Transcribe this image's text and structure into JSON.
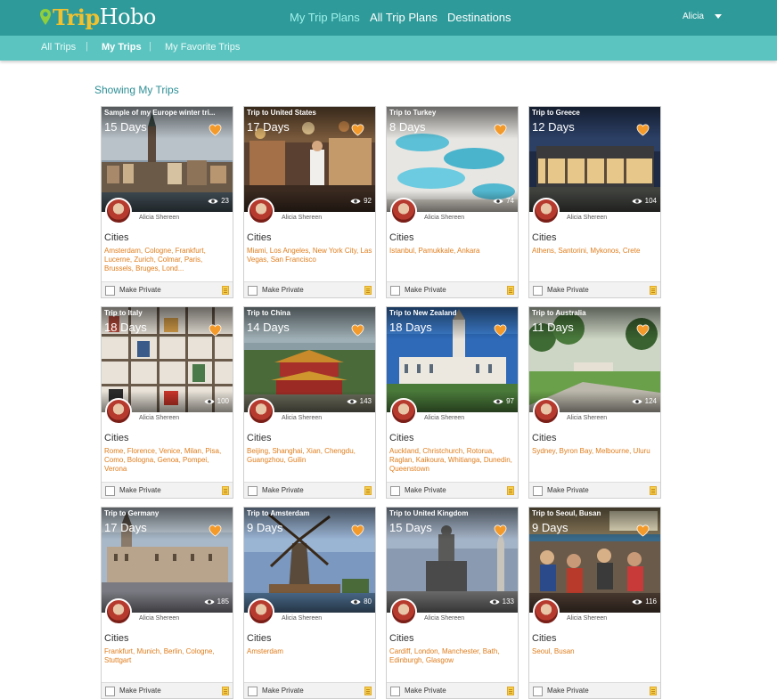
{
  "brand": {
    "trip": "Trip",
    "hobo": "Hobo"
  },
  "nav": {
    "my_trip_plans": "My Trip Plans",
    "all_trip_plans": "All Trip Plans",
    "destinations": "Destinations",
    "user": "Alicia"
  },
  "subnav": {
    "all_trips": "All Trips",
    "my_trips": "My Trips",
    "my_favorite_trips": "My Favorite Trips",
    "separator": "|"
  },
  "showing": "Showing My Trips",
  "colors": {
    "primary": "#2e9a9a",
    "secondary": "#5cc4c0",
    "accent": "#e07d1c",
    "heart": "#f39a2b"
  },
  "card_common": {
    "author": "Alicia Shereen",
    "category": "Cities",
    "make_private": "Make Private"
  },
  "cards": [
    {
      "title": "Sample of my Europe winter tri...",
      "days": "15 Days",
      "views": "23",
      "places": "Amsterdam, Cologne, Frankfurt, Lucerne, Zurich, Colmar, Paris, Brussels, Bruges, Lond...",
      "photo": "zurich"
    },
    {
      "title": "Trip to United States",
      "days": "17 Days",
      "views": "92",
      "places": "Miami, Los Angeles, New York City, Las Vegas, San Francisco",
      "photo": "market"
    },
    {
      "title": "Trip to Turkey",
      "days": "8 Days",
      "views": "74",
      "places": "Istanbul, Pamukkale, Ankara",
      "photo": "pamukkale"
    },
    {
      "title": "Trip to Greece",
      "days": "12 Days",
      "views": "104",
      "places": "Athens, Santorini, Mykonos, Crete",
      "photo": "museum"
    },
    {
      "title": "Trip to Italy",
      "days": "18 Days",
      "views": "100",
      "places": "Rome, Florence, Venice, Milan, Pisa, Como, Bologna, Genoa, Pompei, Verona",
      "photo": "shelves"
    },
    {
      "title": "Trip to China",
      "days": "14 Days",
      "views": "143",
      "places": "Beijing, Shanghai, Xian, Chengdu, Guangzhou, Guilin",
      "photo": "forbidden"
    },
    {
      "title": "Trip to New Zealand",
      "days": "18 Days",
      "views": "97",
      "places": "Auckland, Christchurch, Rotorua, Raglan, Kaikoura, Whitianga, Dunedin, Queenstown",
      "photo": "station"
    },
    {
      "title": "Trip to Australia",
      "days": "11 Days",
      "views": "124",
      "places": "Sydney, Byron Bay, Melbourne, Uluru",
      "photo": "park"
    },
    {
      "title": "Trip to Germany",
      "days": "17 Days",
      "views": "185",
      "places": "Frankfurt, Munich, Berlin, Cologne, Stuttgart",
      "photo": "munich"
    },
    {
      "title": "Trip to Amsterdam",
      "days": "9 Days",
      "views": "80",
      "places": "Amsterdam",
      "photo": "windmill"
    },
    {
      "title": "Trip to United Kingdom",
      "days": "15 Days",
      "views": "133",
      "places": "Cardiff, London, Manchester, Bath, Edinburgh, Glasgow",
      "photo": "statue"
    },
    {
      "title": "Trip to Seoul, Busan",
      "days": "9 Days",
      "views": "116",
      "places": "Seoul, Busan",
      "photo": "street"
    }
  ]
}
